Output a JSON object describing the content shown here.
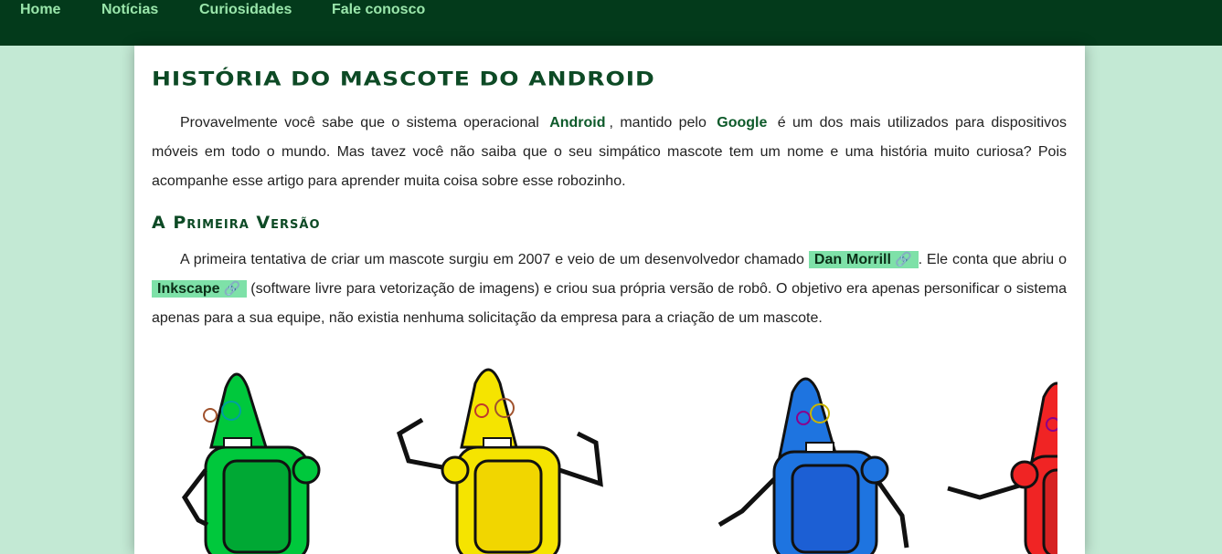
{
  "nav": {
    "items": [
      {
        "label": "Home"
      },
      {
        "label": "Notícias"
      },
      {
        "label": "Curiosidades"
      },
      {
        "label": "Fale conosco"
      }
    ]
  },
  "article": {
    "title": "História do Mascote do Android",
    "p1": {
      "t1": "Provavelmente você sabe que o sistema operacional",
      "android": "Android",
      "t2": ", mantido pelo",
      "google": "Google",
      "t3": "é um dos mais utilizados para dispositivos móveis em todo o mundo. Mas tavez você não saiba que o seu simpático mascote tem um nome e uma história muito curiosa? Pois acompanhe esse artigo para aprender muita coisa sobre esse robozinho."
    },
    "subtitle": "A Primeira Versão",
    "p2": {
      "t1": "A primeira tentativa de criar um mascote surgiu em 2007 e veio de um desenvolvedor chamado",
      "link1": "Dan Morrill",
      "t2": ". Ele conta que abriu o",
      "link2": "Inkscape",
      "t3": "(software livre para vetorização de imagens) e criou sua própria versão de robô. O objetivo era apenas personificar o sistema apenas para a sua equipe, não existia nenhuma solicitação da empresa para a criação de um mascote."
    },
    "link_icon": "paperclip-icon",
    "image": {
      "robot_colors": [
        {
          "fill": "#00c83c",
          "dark": "#00a834"
        },
        {
          "fill": "#f5e400",
          "dark": "#f1d600"
        },
        {
          "fill": "#1e74e0",
          "dark": "#1c5fd4"
        },
        {
          "fill": "#f02424",
          "dark": "#d62222"
        }
      ]
    }
  }
}
